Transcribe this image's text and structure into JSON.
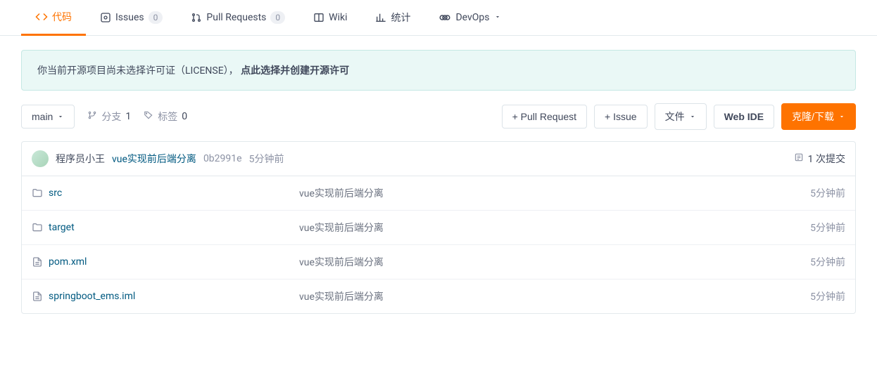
{
  "tabs": {
    "code": "代码",
    "issues": "Issues",
    "issues_count": "0",
    "pr": "Pull Requests",
    "pr_count": "0",
    "wiki": "Wiki",
    "stats": "统计",
    "devops": "DevOps"
  },
  "notice": {
    "text": "你当前开源项目尚未选择许可证（LICENSE），",
    "link": "点此选择并创建开源许可"
  },
  "toolbar": {
    "branch": "main",
    "branches_label": "分支",
    "branches_count": "1",
    "tags_label": "标签",
    "tags_count": "0",
    "pull_request": "+ Pull Request",
    "issue": "+ Issue",
    "file": "文件",
    "web_ide": "Web IDE",
    "clone": "克隆/下载"
  },
  "commit": {
    "author": "程序员小王",
    "message": "vue实现前后端分离",
    "hash": "0b2991e",
    "time": "5分钟前",
    "count_label": "1 次提交"
  },
  "files": [
    {
      "name": "src",
      "type": "folder",
      "msg": "vue实现前后端分离",
      "time": "5分钟前"
    },
    {
      "name": "target",
      "type": "folder",
      "msg": "vue实现前后端分离",
      "time": "5分钟前"
    },
    {
      "name": "pom.xml",
      "type": "file",
      "msg": "vue实现前后端分离",
      "time": "5分钟前"
    },
    {
      "name": "springboot_ems.iml",
      "type": "file",
      "msg": "vue实现前后端分离",
      "time": "5分钟前"
    }
  ]
}
